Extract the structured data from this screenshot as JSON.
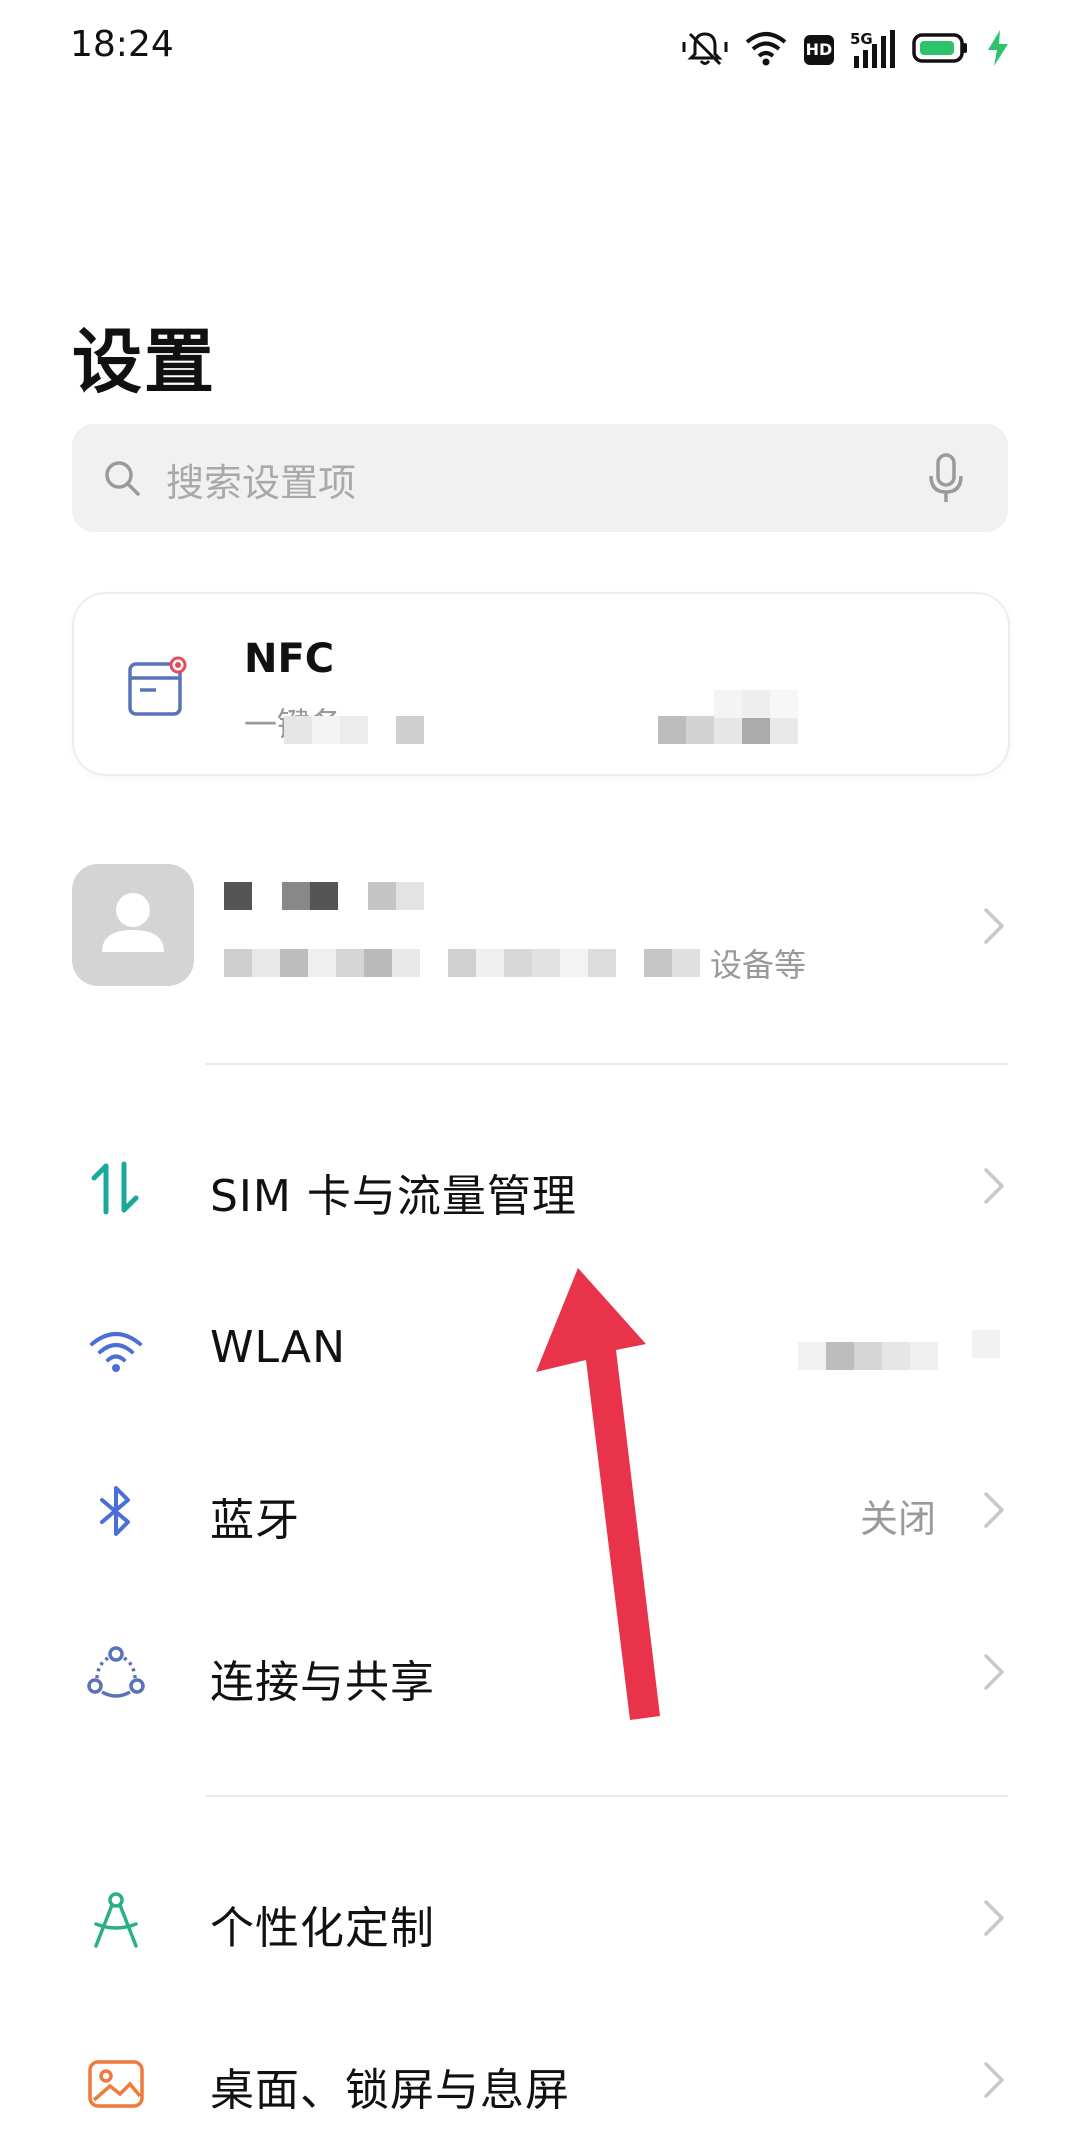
{
  "status_bar": {
    "time": "18:24",
    "icons": [
      "mute-icon",
      "wifi-icon",
      "hd-icon",
      "signal-5g-icon",
      "battery-icon",
      "charging-icon"
    ],
    "signal_label": "5G",
    "hd_label": "HD"
  },
  "page": {
    "title": "设置"
  },
  "search": {
    "placeholder": "搜索设置项",
    "icon": "search-icon",
    "voice_icon": "mic-icon"
  },
  "nfc_card": {
    "title": "NFC",
    "subtitle": "一键备",
    "icon": "nfc-card-icon",
    "accent_color": "#e84c5c"
  },
  "account": {
    "avatar_icon": "person-icon",
    "subtitle_suffix": "设备等"
  },
  "settings": [
    {
      "label": "SIM 卡与流量管理",
      "icon": "sim-data-icon",
      "value": "",
      "icon_color": "#1aa89a"
    },
    {
      "label": "WLAN",
      "icon": "wifi-icon",
      "value": "",
      "icon_color": "#4a6fd8"
    },
    {
      "label": "蓝牙",
      "icon": "bluetooth-icon",
      "value": "关闭",
      "icon_color": "#4a6fd8"
    },
    {
      "label": "连接与共享",
      "icon": "connection-share-icon",
      "value": "",
      "icon_color": "#5a72b8"
    },
    {
      "label": "个性化定制",
      "icon": "personalize-icon",
      "value": "",
      "icon_color": "#2bb07f"
    },
    {
      "label": "桌面、锁屏与息屏",
      "icon": "wallpaper-icon",
      "value": "",
      "icon_color": "#f07a3a"
    }
  ],
  "colors": {
    "annotation_arrow": "#e8334a",
    "divider": "#e9e9e9",
    "search_bg": "#f1f1f1",
    "battery_fill": "#2dc36a"
  }
}
